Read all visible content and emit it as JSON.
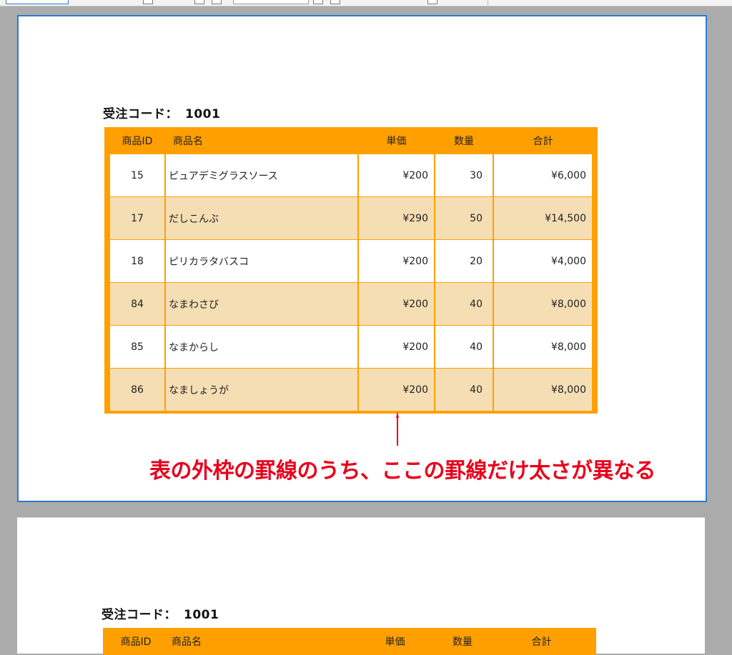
{
  "toolbar": {},
  "page1": {
    "order_title_label": "受注コード：",
    "order_title_value": "1001",
    "headers": [
      "商品ID",
      "商品名",
      "単価",
      "数量",
      "合計"
    ],
    "rows": [
      {
        "id": "15",
        "name": "ピュアデミグラスソース",
        "price": "¥200",
        "qty": "30",
        "total": "¥6,000"
      },
      {
        "id": "17",
        "name": "だしこんぶ",
        "price": "¥290",
        "qty": "50",
        "total": "¥14,500"
      },
      {
        "id": "18",
        "name": "ピリカラタバスコ",
        "price": "¥200",
        "qty": "20",
        "total": "¥4,000"
      },
      {
        "id": "84",
        "name": "なまわさび",
        "price": "¥200",
        "qty": "40",
        "total": "¥8,000"
      },
      {
        "id": "85",
        "name": "なまからし",
        "price": "¥200",
        "qty": "40",
        "total": "¥8,000"
      },
      {
        "id": "86",
        "name": "なましょうが",
        "price": "¥200",
        "qty": "40",
        "total": "¥8,000"
      }
    ],
    "annotation": "表の外枠の罫線のうち、ここの罫線だけ太さが異なる"
  },
  "page2": {
    "order_title_label": "受注コード：",
    "order_title_value": "1001",
    "headers": [
      "商品ID",
      "商品名",
      "単価",
      "数量",
      "合計"
    ]
  },
  "colors": {
    "table_border": "#ffa000",
    "row_alt": "#f6deb4",
    "annotation": "#e8001c",
    "page_selected_border": "#2a7bd4",
    "workspace": "#ababab"
  }
}
